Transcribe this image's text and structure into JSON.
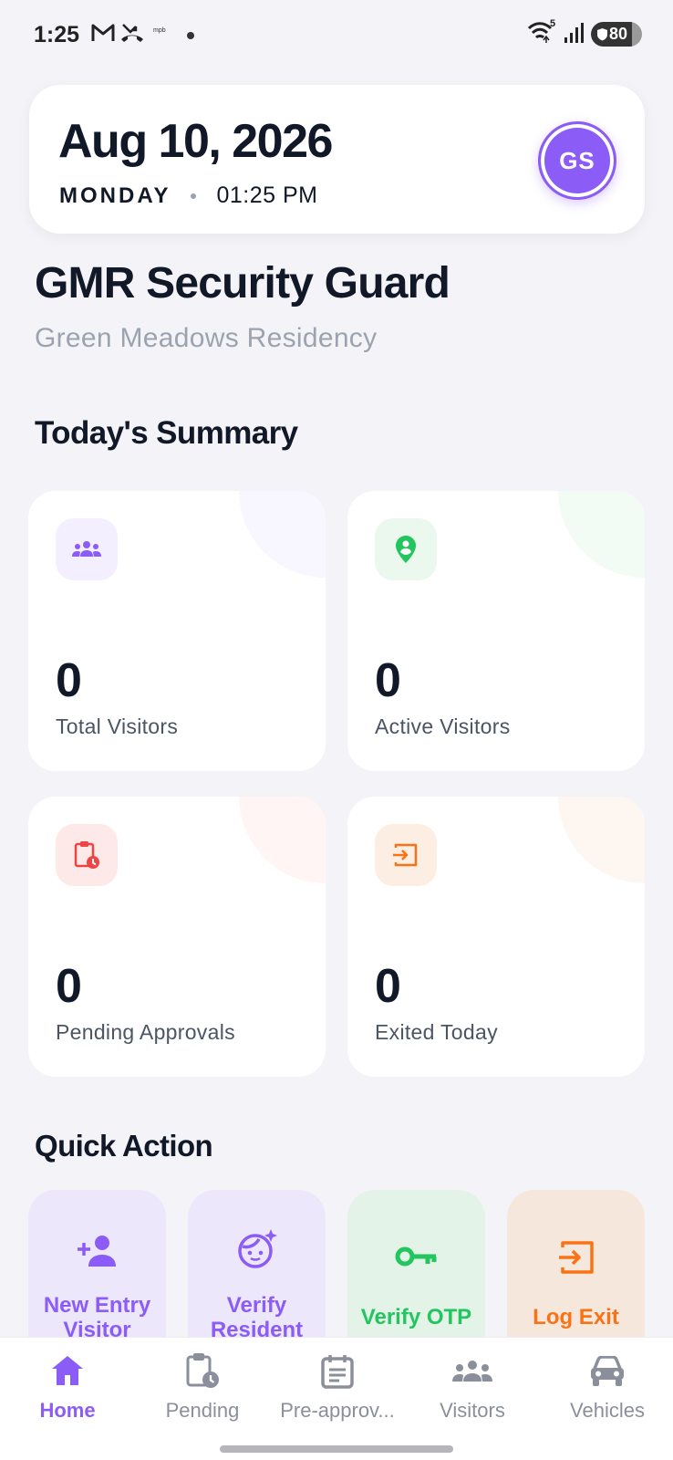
{
  "status_bar": {
    "time": "1:25",
    "app_text": "mpb",
    "wifi_badge": "5",
    "battery": "80"
  },
  "header": {
    "date": "Aug 10, 2026",
    "day": "MONDAY",
    "time": "01:25 PM",
    "avatar_initials": "GS"
  },
  "app": {
    "title": "GMR Security Guard",
    "community": "Green Meadows Residency"
  },
  "summary": {
    "title": "Today's Summary",
    "cards": [
      {
        "value": "0",
        "label": "Total Visitors",
        "icon": "group-icon",
        "color": "#8b5cf6"
      },
      {
        "value": "0",
        "label": "Active Visitors",
        "icon": "location-pin-icon",
        "color": "#22c55e"
      },
      {
        "value": "0",
        "label": "Pending Approvals",
        "icon": "clipboard-clock-icon",
        "color": "#ef4444"
      },
      {
        "value": "0",
        "label": "Exited Today",
        "icon": "exit-icon",
        "color": "#f97316"
      }
    ]
  },
  "quick_action": {
    "title": "Quick Action",
    "items": [
      {
        "label_line1": "New Entry",
        "label_line2": "Visitor",
        "icon": "add-person-icon",
        "color": "#8b5cf6"
      },
      {
        "label_line1": "Verify",
        "label_line2": "Resident",
        "icon": "face-icon",
        "color": "#8b5cf6"
      },
      {
        "label_line1": "Verify OTP",
        "icon": "key-icon",
        "color": "#22c55e"
      },
      {
        "label_line1": "Log Exit",
        "icon": "exit-icon",
        "color": "#f97316"
      }
    ]
  },
  "nav": {
    "items": [
      {
        "label": "Home",
        "icon": "home-icon"
      },
      {
        "label": "Pending",
        "icon": "clipboard-clock-icon"
      },
      {
        "label": "Pre-approv...",
        "icon": "calendar-list-icon"
      },
      {
        "label": "Visitors",
        "icon": "group-icon"
      },
      {
        "label": "Vehicles",
        "icon": "car-icon"
      }
    ]
  },
  "colors": {
    "accent": "#8b5cf6",
    "green": "#22c55e",
    "red": "#ef4444",
    "orange": "#f97316"
  }
}
